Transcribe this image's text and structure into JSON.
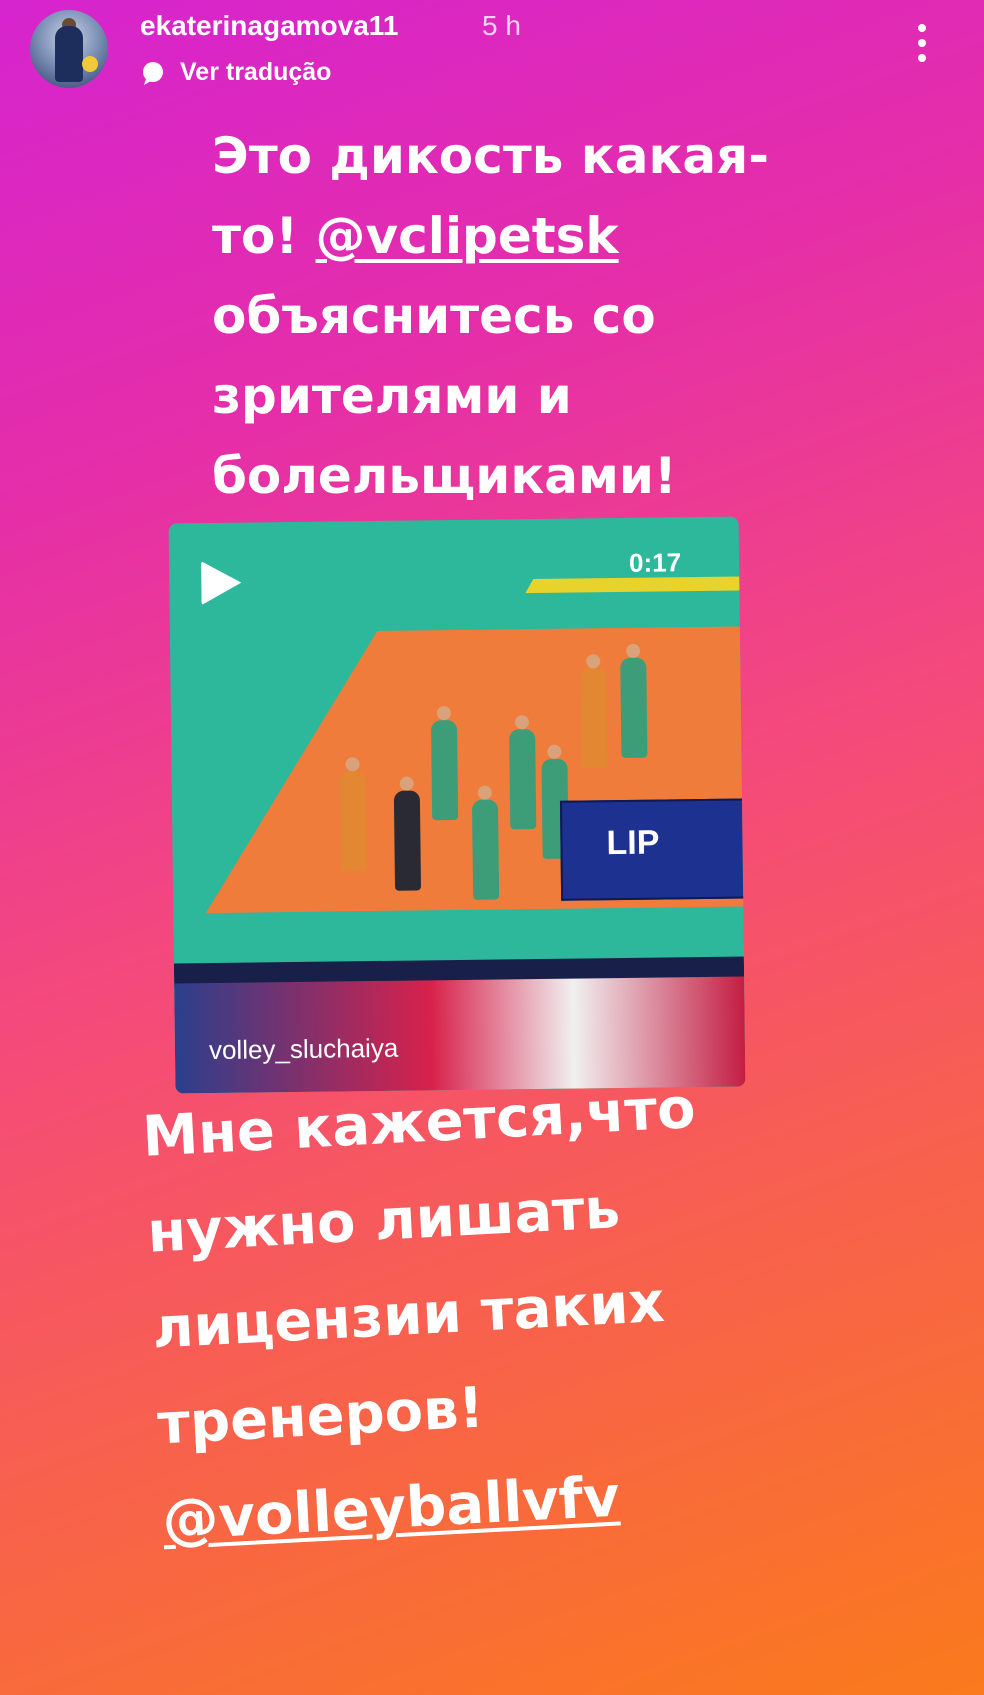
{
  "header": {
    "username": "ekaterinagamova11",
    "time": "5 h",
    "translate_label": "Ver tradução"
  },
  "story": {
    "text_top_line1": "Это дикость какая-",
    "text_top_line2a": "то! ",
    "text_top_mention": "@vclipetsk",
    "text_top_line3": "объяснитесь со",
    "text_top_line4": "зрителями и",
    "text_top_line5": "болельщиками!",
    "video": {
      "duration": "0:17",
      "score_label": "LIP",
      "watermark": "volley_sluchaiya"
    },
    "text_bottom_line1": "Мне кажется,что",
    "text_bottom_line2": "нужно лишать",
    "text_bottom_line3": "лицензии таких",
    "text_bottom_line4": "тренеров!",
    "text_bottom_mention": "@volleyballvfv"
  },
  "colors": {
    "gradient_start": "#d624cf",
    "gradient_end": "#fa7a1c",
    "text": "#ffffff"
  },
  "icons": [
    "translate-bubble-icon",
    "more-options-icon",
    "play-icon"
  ]
}
